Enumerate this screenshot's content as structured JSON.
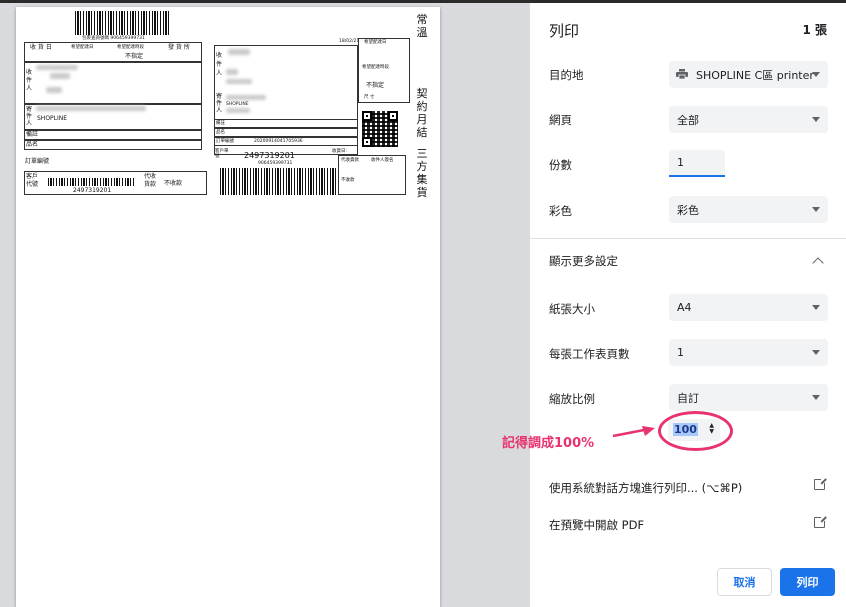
{
  "preview": {
    "barcode_number_top": "包裹查詢號碼 906459399731",
    "table_headers": [
      "收 貨 日",
      "希望配達日",
      "希望配達時段",
      "發 貨 所"
    ],
    "unspecified": "不指定",
    "receiver_label": "收件人",
    "sender_label": "寄件人",
    "sender_name": "SHOPLINE",
    "remark_label": "備註",
    "item_label": "品名",
    "order_no_label": "訂單編號",
    "customer_code_label": "客戶代號",
    "customer_code": "2497319201",
    "collect_label": "代收貨款",
    "no_collect": "不收款",
    "right_code_small": "18/02/21",
    "right_hope_date": "希望配達日",
    "right_hope_time": "希望配達時段",
    "right_unspecified": "不指定",
    "right_size_label": "尺 寸",
    "right_order_label": "訂單編號",
    "right_order_no": "20200914041705936",
    "right_customer_code": "2497319201",
    "right_customer_label": "客戶單號",
    "right_receive_day": "收貨日:",
    "right_barcode_num": "906459399731",
    "right_collect_label": "代收貨款",
    "right_sign_label": "收件人簽名",
    "right_no_collect": "不收款",
    "vertical_text_1": "常溫",
    "vertical_text_2": "契約月結",
    "vertical_text_3": "三方集貨"
  },
  "panel": {
    "title": "列印",
    "sheet_count": "1 張",
    "destination_label": "目的地",
    "destination_value": "SHOPLINE C區 printer",
    "pages_label": "網頁",
    "pages_value": "全部",
    "copies_label": "份數",
    "copies_value": "1",
    "color_label": "彩色",
    "color_value": "彩色",
    "more_settings_label": "顯示更多設定",
    "paper_size_label": "紙張大小",
    "paper_size_value": "A4",
    "pages_per_sheet_label": "每張工作表頁數",
    "pages_per_sheet_value": "1",
    "scale_label": "縮放比例",
    "scale_value": "自訂",
    "scale_input_value": "100",
    "system_dialog_label": "使用系統對話方塊進行列印... (⌥⌘P)",
    "open_pdf_label": "在預覽中開啟 PDF",
    "cancel_button": "取消",
    "print_button": "列印"
  },
  "annotation": {
    "text": "記得調成100%",
    "color": "#e8336f"
  },
  "colors": {
    "accent": "#1a73e8",
    "annotation": "#e8336f",
    "preview_bg": "#d9dadd"
  }
}
